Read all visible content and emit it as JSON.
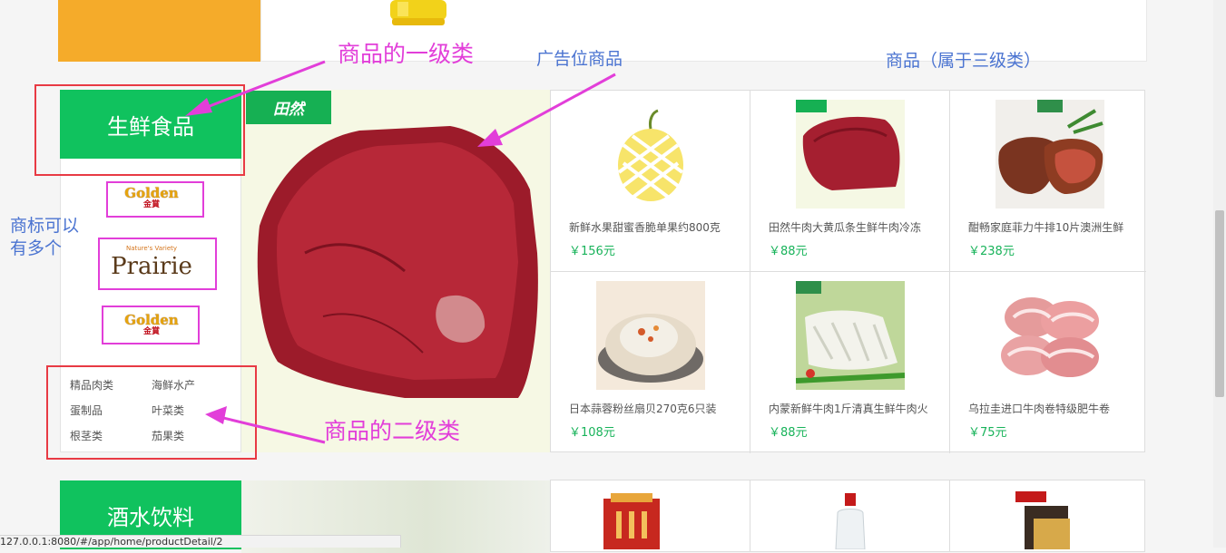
{
  "category1": {
    "title": "生鲜食品",
    "brands": [
      {
        "name": "golden-logo",
        "text": "Golden",
        "sub": "金賞"
      },
      {
        "name": "prairie-logo",
        "text": "Prairie",
        "sub": "Nature's Variety"
      },
      {
        "name": "golden-logo",
        "text": "Golden",
        "sub": "金賞"
      }
    ],
    "subcategories": [
      "精品肉类",
      "海鲜水产",
      "蛋制品",
      "叶菜类",
      "根茎类",
      "茄果类"
    ],
    "ad_logo": "田然",
    "products": [
      {
        "name": "新鲜水果甜蜜香脆单果约800克",
        "price": "￥156元",
        "icon": "melon-image"
      },
      {
        "name": "田然牛肉大黄瓜条生鲜牛肉冷冻",
        "price": "￥88元",
        "icon": "beef-image"
      },
      {
        "name": "酣畅家庭菲力牛排10片澳洲生鲜",
        "price": "￥238元",
        "icon": "steak-image"
      },
      {
        "name": "日本蒜蓉粉丝扇贝270克6只装",
        "price": "￥108元",
        "icon": "scallop-image"
      },
      {
        "name": "内蒙新鲜牛肉1斤清真生鲜牛肉火",
        "price": "￥88元",
        "icon": "tripe-image"
      },
      {
        "name": "乌拉圭进口牛肉卷特级肥牛卷",
        "price": "￥75元",
        "icon": "beef-roll-image"
      }
    ]
  },
  "category2": {
    "title": "酒水饮料"
  },
  "annotations": {
    "level1": "商品的一级类",
    "ad": "广告位商品",
    "level3": "商品（属于三级类）",
    "brands": "商标可以\n有多个",
    "brands_line1": "商标可以",
    "brands_line2": "有多个",
    "level2": "商品的二级类"
  },
  "status_url": "127.0.0.1:8080/#/app/home/productDetail/2",
  "colors": {
    "accent_green": "#10c25e",
    "price_green": "#18b35a",
    "annotation_magenta": "#e23ed9",
    "annotation_red": "#e83a44",
    "annotation_blue": "#4b74d1"
  }
}
